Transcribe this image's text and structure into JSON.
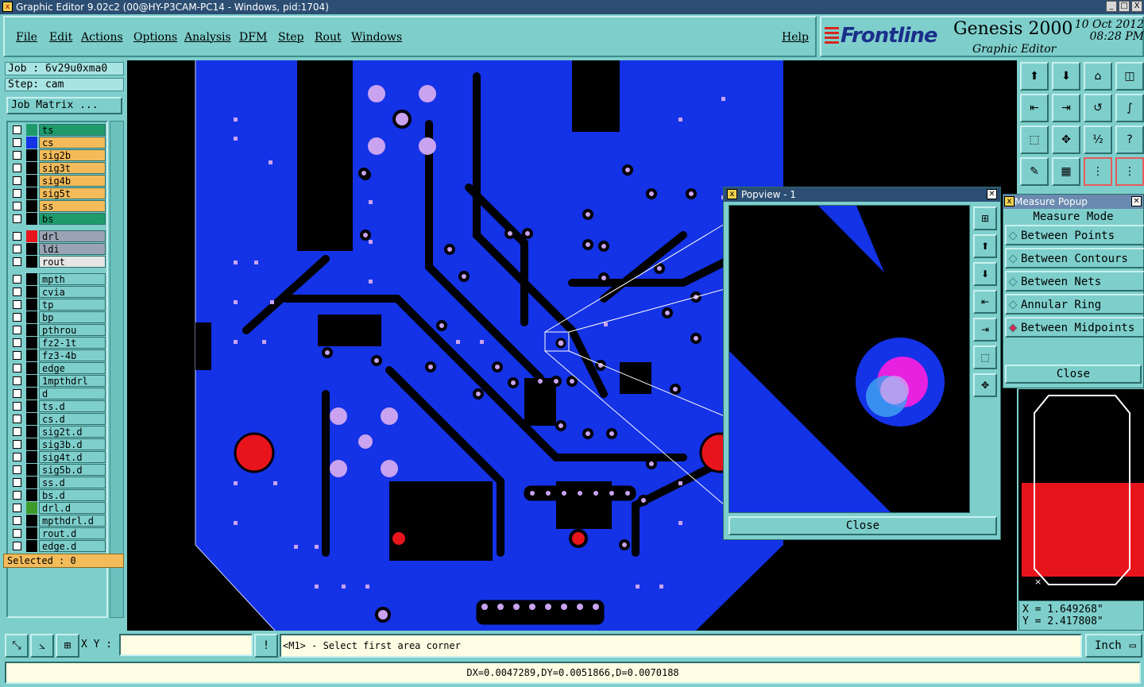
{
  "window": {
    "title": "Graphic Editor 9.02c2 (00@HY-P3CAM-PC14 - Windows, pid:1704)",
    "min": "_",
    "max": "□",
    "close": "X"
  },
  "menu": {
    "file": "File",
    "edit": "Edit",
    "actions": "Actions",
    "options": "Options",
    "analysis": "Analysis",
    "dfm": "DFM",
    "step": "Step",
    "rout": "Rout",
    "windows": "Windows",
    "help": "Help"
  },
  "brand": {
    "logo": "Frontline",
    "product": "Genesis 2000",
    "subtitle": "Graphic Editor",
    "date": "10 Oct 2012",
    "time": "08:28 PM"
  },
  "job": {
    "job_label": "Job : 6v29u0xma0",
    "step_label": "Step: cam",
    "matrix_button": "Job Matrix ..."
  },
  "layers": [
    {
      "name": "ts",
      "bg": "#1f9a6b",
      "swatch": "#1f9a6b"
    },
    {
      "name": "cs",
      "bg": "#f3bb5a",
      "swatch": "#1432e6"
    },
    {
      "name": "sig2b",
      "bg": "#f3bb5a",
      "swatch": "#000000"
    },
    {
      "name": "sig3t",
      "bg": "#f3bb5a",
      "swatch": "#000000"
    },
    {
      "name": "sig4b",
      "bg": "#f3bb5a",
      "swatch": "#000000"
    },
    {
      "name": "sig5t",
      "bg": "#f3bb5a",
      "swatch": "#000000"
    },
    {
      "name": "ss",
      "bg": "#f3bb5a",
      "swatch": "#000000"
    },
    {
      "name": "bs",
      "bg": "#1f9a6b",
      "swatch": "#000000"
    },
    {
      "name": "drl",
      "bg": "#9aa3b4",
      "swatch": "#e8141c"
    },
    {
      "name": "ldi",
      "bg": "#9aa3b4",
      "swatch": "#000000"
    },
    {
      "name": "rout",
      "bg": "#e6e6e6",
      "swatch": "#000000"
    },
    {
      "name": "mpth",
      "bg": "#7ecfcc",
      "swatch": "#000000"
    },
    {
      "name": "cvia",
      "bg": "#7ecfcc",
      "swatch": "#000000"
    },
    {
      "name": "tp",
      "bg": "#7ecfcc",
      "swatch": "#000000"
    },
    {
      "name": "bp",
      "bg": "#7ecfcc",
      "swatch": "#000000"
    },
    {
      "name": "pthrou",
      "bg": "#7ecfcc",
      "swatch": "#000000"
    },
    {
      "name": "fz2-1t",
      "bg": "#7ecfcc",
      "swatch": "#000000"
    },
    {
      "name": "fz3-4b",
      "bg": "#7ecfcc",
      "swatch": "#000000"
    },
    {
      "name": "edge",
      "bg": "#7ecfcc",
      "swatch": "#000000"
    },
    {
      "name": "1mpthdrl",
      "bg": "#7ecfcc",
      "swatch": "#000000"
    },
    {
      "name": "d",
      "bg": "#7ecfcc",
      "swatch": "#000000"
    },
    {
      "name": "ts.d",
      "bg": "#7ecfcc",
      "swatch": "#000000"
    },
    {
      "name": "cs.d",
      "bg": "#7ecfcc",
      "swatch": "#000000"
    },
    {
      "name": "sig2t.d",
      "bg": "#7ecfcc",
      "swatch": "#000000"
    },
    {
      "name": "sig3b.d",
      "bg": "#7ecfcc",
      "swatch": "#000000"
    },
    {
      "name": "sig4t.d",
      "bg": "#7ecfcc",
      "swatch": "#000000"
    },
    {
      "name": "sig5b.d",
      "bg": "#7ecfcc",
      "swatch": "#000000"
    },
    {
      "name": "ss.d",
      "bg": "#7ecfcc",
      "swatch": "#000000"
    },
    {
      "name": "bs.d",
      "bg": "#7ecfcc",
      "swatch": "#000000"
    },
    {
      "name": "drl.d",
      "bg": "#7ecfcc",
      "swatch": "#3e9a2a"
    },
    {
      "name": "mpthdrl.d",
      "bg": "#7ecfcc",
      "swatch": "#000000"
    },
    {
      "name": "rout.d",
      "bg": "#7ecfcc",
      "swatch": "#000000"
    },
    {
      "name": "edge.d",
      "bg": "#7ecfcc",
      "swatch": "#000000"
    }
  ],
  "selected": "Selected : 0",
  "popview": {
    "title": "Popview - 1",
    "close": "Close"
  },
  "measure": {
    "title": "Measure Popup",
    "mode_label": "Measure Mode",
    "options": [
      "Between Points",
      "Between Contours",
      "Between Nets",
      "Annular Ring",
      "Between Midpoints"
    ],
    "active": "Between Midpoints",
    "close": "Close"
  },
  "coords": {
    "x": "X = 1.649268\"",
    "y": "Y = 2.417808\""
  },
  "bottom": {
    "xy_label": "X Y :",
    "xy_value": "",
    "prompt": "<M1> - Select first area corner",
    "unit": "Inch"
  },
  "status": "DX=0.0047289,DY=0.0051866,D=0.0070188",
  "colors": {
    "board_blue": "#1432e6",
    "pad_pink": "#c9a3f0",
    "drill_red": "#e8141c",
    "panel_teal": "#7ecfcc"
  }
}
